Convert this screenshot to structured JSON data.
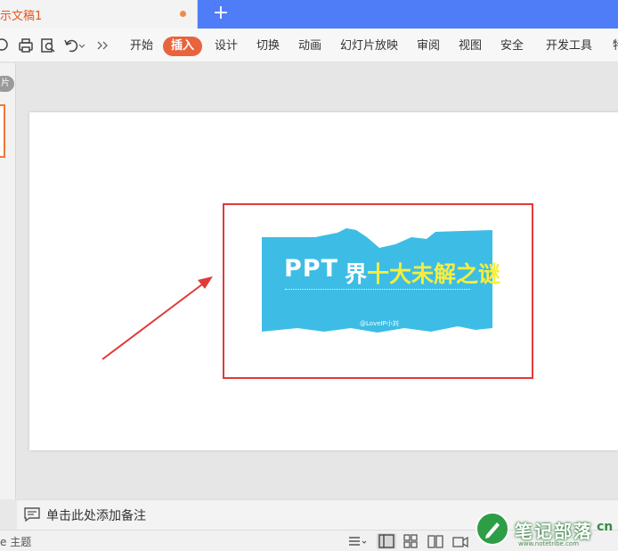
{
  "titlebar": {
    "doc_title": "示文稿1",
    "new_tab_label": "+"
  },
  "quick_access": [
    {
      "icon": "cloud-save-icon"
    },
    {
      "icon": "print-icon"
    },
    {
      "icon": "print-preview-icon"
    },
    {
      "icon": "undo-icon"
    },
    {
      "icon": "more-commands-icon"
    }
  ],
  "ribbon": {
    "tabs": [
      {
        "label": "开始"
      },
      {
        "label": "插入",
        "active": true
      },
      {
        "label": "设计"
      },
      {
        "label": "切换"
      },
      {
        "label": "动画"
      },
      {
        "label": "幻灯片放映"
      },
      {
        "label": "审阅"
      },
      {
        "label": "视图"
      },
      {
        "label": "安全"
      },
      {
        "label": "开发工具"
      },
      {
        "label": "特"
      }
    ]
  },
  "slide_panel": {
    "toggle_label": "片"
  },
  "slide": {
    "image": {
      "title_latin": "PPT",
      "title_mid": "界",
      "title_cn": "十大未解之谜",
      "author": "@LoveIP小刘"
    }
  },
  "notes": {
    "placeholder": "单击此处添加备注"
  },
  "statusbar": {
    "theme_label": "e 主题"
  },
  "watermark": {
    "brand": "笔记部落",
    "domain": "www.notetribe.com",
    "suffix": "cn"
  },
  "colors": {
    "title_accent": "#4f7df7",
    "active_tab": "#e8643c",
    "doc_title": "#e4581d",
    "image_bg": "#3dbde5",
    "image_title_yellow": "#f7ee3b",
    "highlight": "#e03a3a"
  }
}
